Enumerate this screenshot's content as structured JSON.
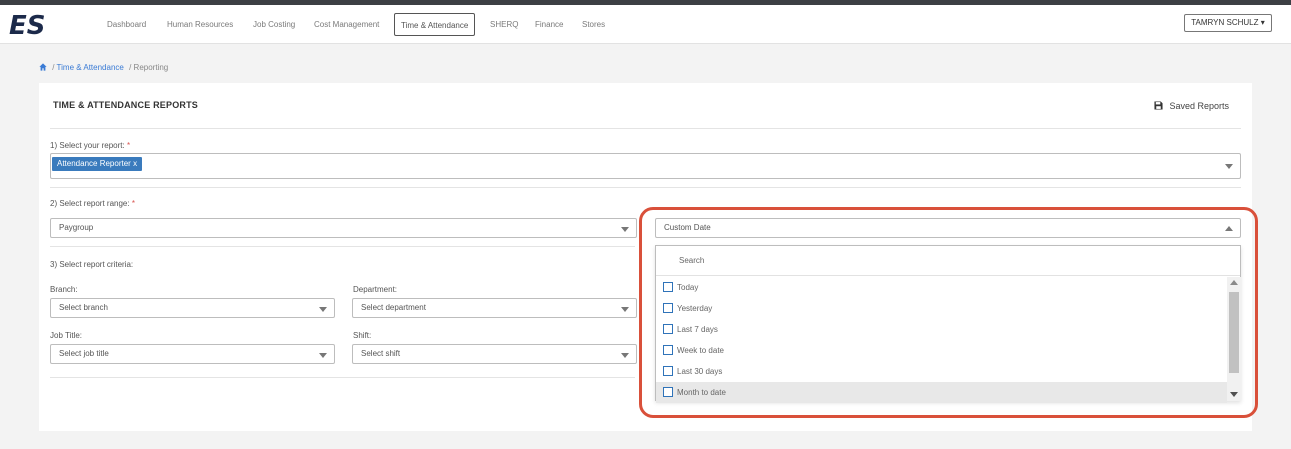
{
  "nav": {
    "logo_text": "ES",
    "items": [
      "Dashboard",
      "Human Resources",
      "Job Costing",
      "Cost Management",
      "Time & Attendance",
      "SHERQ",
      "Finance",
      "Stores"
    ],
    "active": "Time & Attendance",
    "user": "TAMRYN SCHULZ"
  },
  "breadcrumb": {
    "link": "Time & Attendance",
    "current": "Reporting",
    "separator": "/"
  },
  "panel": {
    "title": "TIME & ATTENDANCE REPORTS",
    "saved_reports": "Saved Reports"
  },
  "report": {
    "label": "1) Select your report:",
    "required": "*",
    "selected_tag": "Attendance Reporter",
    "tag_remove": "x"
  },
  "range": {
    "label": "2) Select report range:",
    "required": "*",
    "type_value": "Paygroup",
    "date_value": "Custom Date"
  },
  "criteria": {
    "label": "3) Select report criteria:",
    "branch_label": "Branch:",
    "branch_placeholder": "Select branch",
    "department_label": "Department:",
    "department_placeholder": "Select department",
    "job_title_label": "Job Title:",
    "job_title_placeholder": "Select job title",
    "shift_label": "Shift:",
    "shift_placeholder": "Select shift"
  },
  "dropdown": {
    "search_placeholder": "Search",
    "options": [
      "Today",
      "Yesterday",
      "Last 7 days",
      "Week to date",
      "Last 30 days",
      "Month to date"
    ],
    "hovered_option": "Month to date"
  },
  "colors": {
    "accent": "#3a7bbd",
    "link": "#3a7bd5",
    "highlight": "#d9503a",
    "topbar": "#3c3f44"
  },
  "icons": {
    "home": "home-icon",
    "save": "floppy-disk-icon",
    "caret": "caret-down-icon"
  }
}
